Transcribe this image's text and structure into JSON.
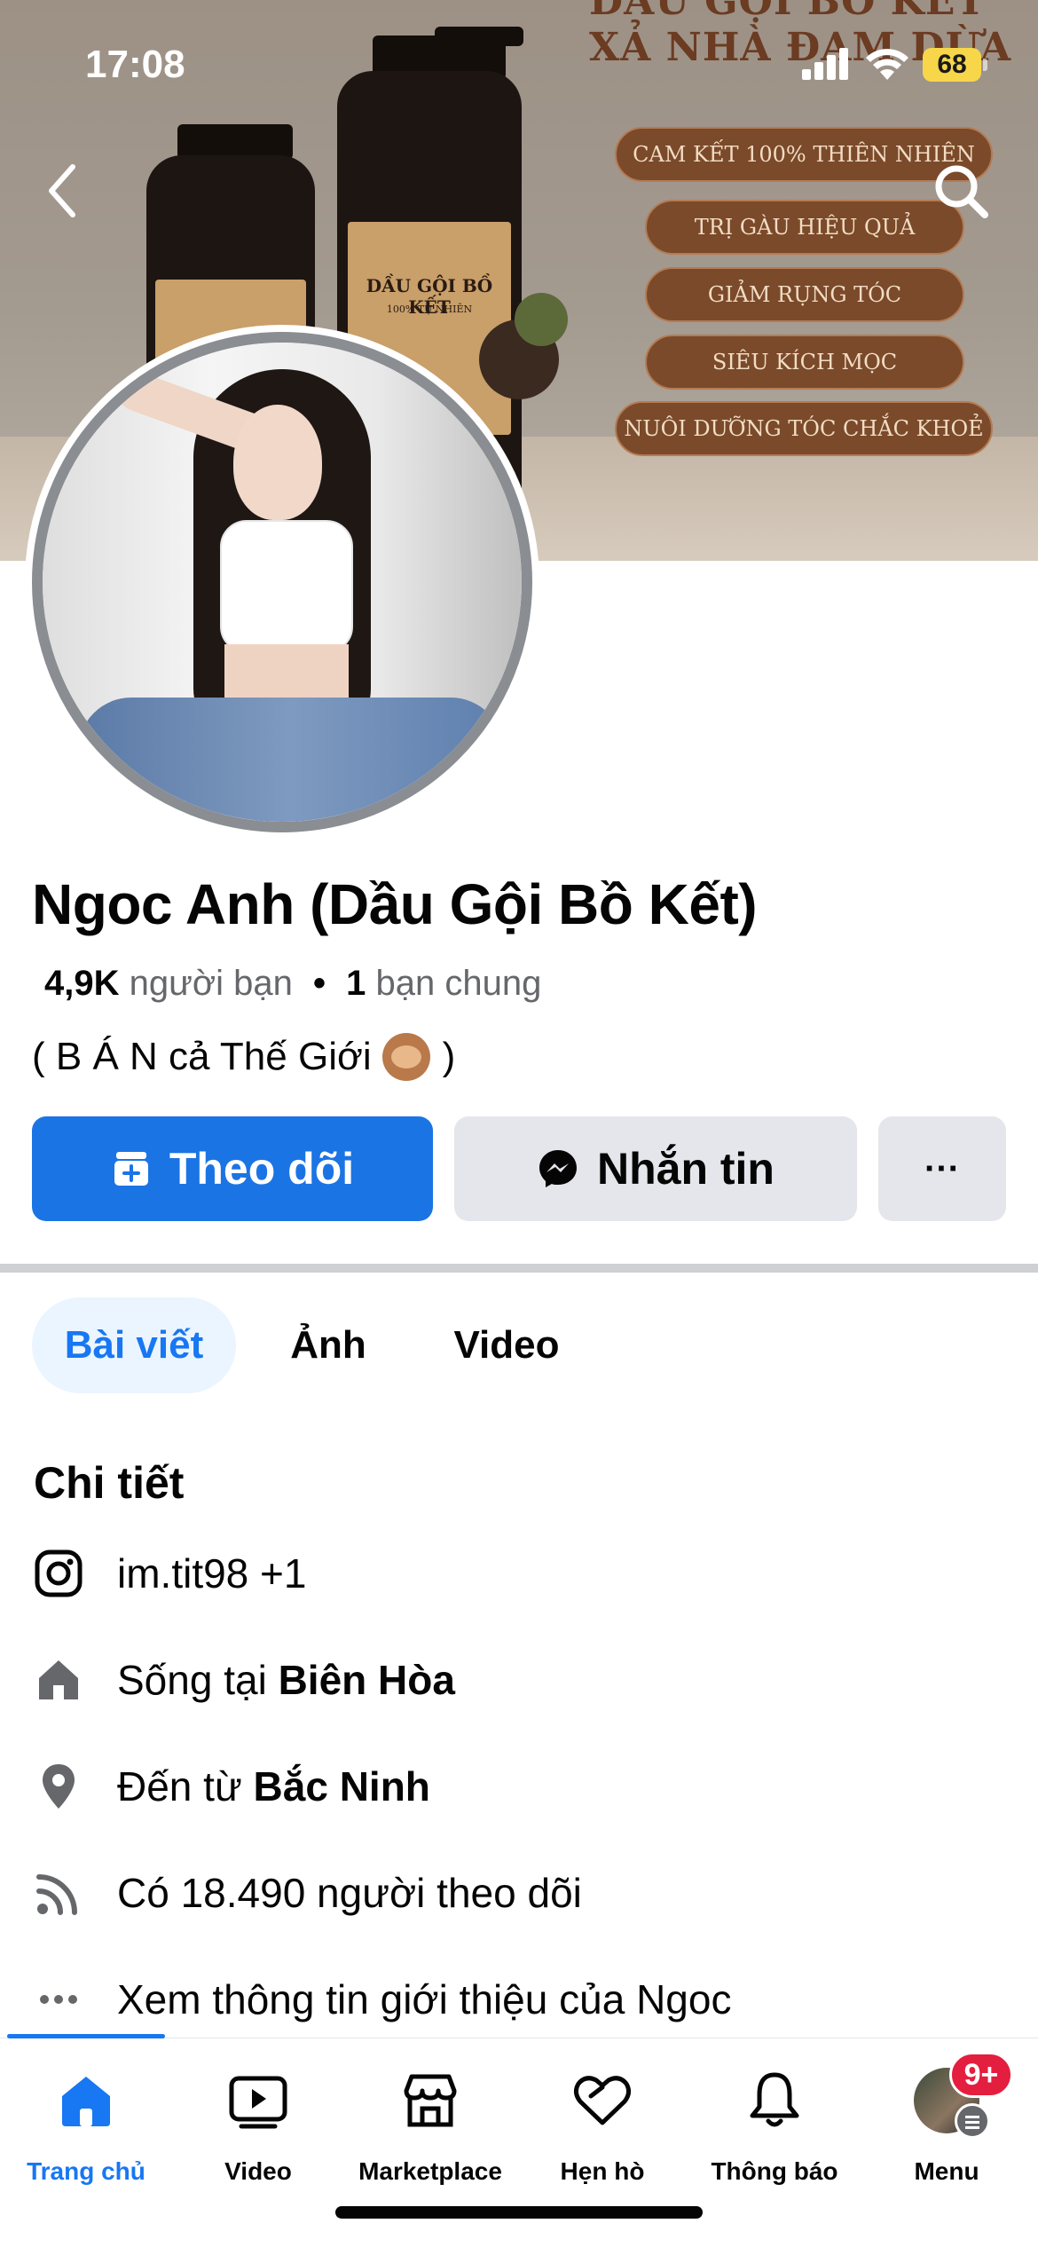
{
  "status_bar": {
    "time": "17:08",
    "battery": "68"
  },
  "cover": {
    "headline_1": "DẦU GỘI BỒ KẾT",
    "headline_2": "XẢ NHÀ ĐAM DỪA",
    "bottle_label": "DẦU GỘI BỒ KẾT",
    "bottle_sublabel": "100% TỰ NHIÊN",
    "pills": [
      "CAM KẾT 100% THIÊN NHIÊN",
      "TRỊ GÀU HIỆU QUẢ",
      "GIẢM RỤNG TÓC",
      "SIÊU KÍCH MỌC",
      "NUÔI DƯỠNG TÓC CHẮC KHOẺ"
    ]
  },
  "profile": {
    "name": "Ngoc Anh (Dầu Gội Bồ Kết)",
    "friends_count": "4,9K",
    "friends_label": "người bạn",
    "separator": "•",
    "mutual_count": "1",
    "mutual_label": "bạn chung",
    "bio_prefix": "( B Á N cả Thế Giới",
    "bio_suffix": ")"
  },
  "actions": {
    "follow": "Theo dõi",
    "message": "Nhắn tin",
    "more": "···"
  },
  "tabs": [
    {
      "label": "Bài viết",
      "active": true
    },
    {
      "label": "Ảnh",
      "active": false
    },
    {
      "label": "Video",
      "active": false
    }
  ],
  "details": {
    "title": "Chi tiết",
    "instagram": "im.tit98 +1",
    "lives_prefix": "Sống tại",
    "lives_place": "Biên Hòa",
    "from_prefix": "Đến từ",
    "from_place": "Bắc Ninh",
    "followers": "Có 18.490 người theo dõi",
    "see_intro": "Xem thông tin giới thiệu của Ngoc"
  },
  "bottom_nav": {
    "items": [
      {
        "label": "Trang chủ",
        "icon": "home-icon",
        "active": true
      },
      {
        "label": "Video",
        "icon": "video-icon",
        "active": false
      },
      {
        "label": "Marketplace",
        "icon": "marketplace-icon",
        "active": false
      },
      {
        "label": "Hẹn hò",
        "icon": "dating-heart-icon",
        "active": false
      },
      {
        "label": "Thông báo",
        "icon": "bell-icon",
        "active": false
      },
      {
        "label": "Menu",
        "icon": "menu-avatar",
        "active": false
      }
    ],
    "badge": "9+"
  },
  "colors": {
    "accent": "#1877f2",
    "follow_button": "#1b74e4",
    "secondary_button": "#e4e6eb",
    "badge": "#e41e3f"
  }
}
